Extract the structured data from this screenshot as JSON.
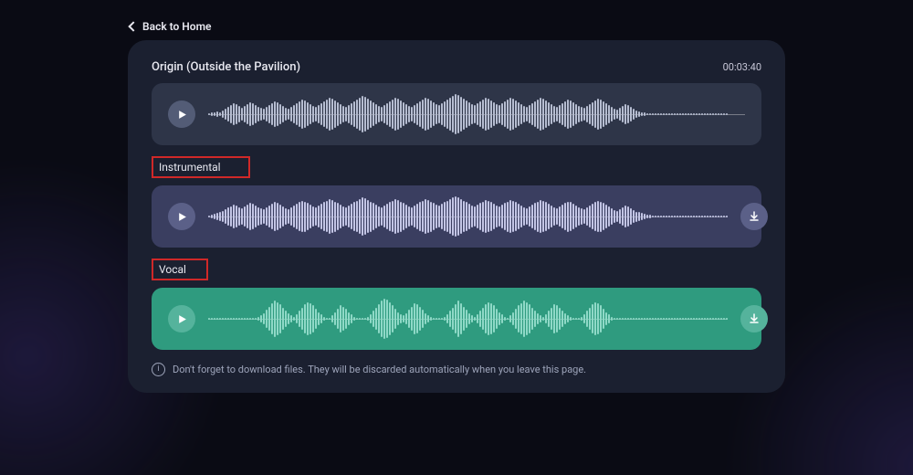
{
  "nav": {
    "back_label": "Back to Home"
  },
  "header": {
    "title": "Origin (Outside the Pavilion)",
    "duration": "00:03:40"
  },
  "tracks": {
    "instrumental_label": "Instrumental",
    "vocal_label": "Vocal"
  },
  "footer": {
    "note": "Don't forget to download files. They will be discarded automatically when you leave this page."
  },
  "waves": {
    "origin": [
      1,
      2,
      2,
      3,
      2,
      4,
      6,
      8,
      10,
      12,
      11,
      9,
      7,
      9,
      11,
      13,
      12,
      10,
      8,
      7,
      6,
      8,
      10,
      12,
      14,
      13,
      11,
      9,
      7,
      6,
      8,
      10,
      12,
      14,
      16,
      15,
      13,
      11,
      9,
      8,
      10,
      12,
      14,
      16,
      18,
      17,
      15,
      13,
      11,
      9,
      8,
      10,
      12,
      14,
      16,
      18,
      20,
      19,
      17,
      15,
      13,
      11,
      9,
      8,
      10,
      12,
      14,
      16,
      18,
      17,
      15,
      13,
      11,
      9,
      8,
      10,
      12,
      14,
      16,
      18,
      17,
      15,
      13,
      11,
      10,
      12,
      14,
      16,
      18,
      20,
      22,
      21,
      19,
      17,
      15,
      13,
      11,
      10,
      12,
      14,
      16,
      18,
      17,
      15,
      13,
      11,
      10,
      12,
      14,
      16,
      18,
      17,
      15,
      13,
      11,
      9,
      8,
      10,
      12,
      14,
      16,
      18,
      17,
      15,
      13,
      11,
      9,
      8,
      10,
      12,
      14,
      16,
      15,
      13,
      11,
      9,
      8,
      7,
      9,
      11,
      13,
      15,
      17,
      16,
      14,
      12,
      10,
      8,
      6,
      5,
      7,
      9,
      11,
      10,
      8,
      6,
      4,
      3,
      2,
      2,
      1,
      1,
      1,
      1,
      1,
      1,
      1,
      1,
      1,
      1,
      1,
      1,
      1,
      1,
      1,
      1,
      1,
      1,
      1,
      1,
      1,
      1,
      1,
      1,
      1,
      1,
      1,
      1,
      1,
      1
    ],
    "instrumental": [
      1,
      2,
      3,
      4,
      5,
      7,
      9,
      11,
      12,
      14,
      13,
      11,
      10,
      12,
      14,
      16,
      15,
      13,
      11,
      10,
      9,
      11,
      13,
      15,
      17,
      16,
      14,
      12,
      10,
      9,
      11,
      13,
      15,
      17,
      19,
      18,
      16,
      14,
      12,
      11,
      13,
      15,
      17,
      19,
      21,
      20,
      18,
      16,
      14,
      12,
      11,
      13,
      15,
      17,
      19,
      21,
      23,
      22,
      20,
      18,
      16,
      14,
      12,
      11,
      13,
      15,
      17,
      19,
      21,
      20,
      18,
      16,
      14,
      12,
      11,
      13,
      15,
      17,
      19,
      21,
      20,
      18,
      16,
      14,
      13,
      15,
      17,
      19,
      21,
      23,
      24,
      23,
      21,
      19,
      17,
      15,
      13,
      12,
      14,
      16,
      18,
      20,
      19,
      17,
      15,
      13,
      12,
      14,
      16,
      18,
      20,
      19,
      17,
      15,
      13,
      11,
      10,
      12,
      14,
      16,
      18,
      20,
      19,
      17,
      15,
      13,
      11,
      10,
      12,
      14,
      16,
      18,
      17,
      15,
      13,
      11,
      10,
      9,
      11,
      13,
      15,
      17,
      19,
      18,
      16,
      14,
      12,
      10,
      8,
      7,
      9,
      11,
      13,
      12,
      10,
      8,
      6,
      5,
      4,
      3,
      2,
      2,
      1,
      1,
      1,
      1,
      1,
      1,
      1,
      1,
      1,
      1,
      1,
      1,
      1,
      1,
      1,
      1,
      1,
      1,
      1,
      1,
      1,
      1,
      1,
      1,
      1,
      1,
      1,
      1
    ],
    "vocal": [
      1,
      1,
      1,
      1,
      1,
      1,
      1,
      1,
      1,
      1,
      1,
      1,
      1,
      1,
      1,
      1,
      1,
      1,
      2,
      3,
      5,
      8,
      11,
      14,
      16,
      15,
      13,
      10,
      7,
      5,
      3,
      2,
      4,
      7,
      10,
      13,
      15,
      14,
      12,
      9,
      6,
      4,
      2,
      1,
      1,
      3,
      6,
      9,
      12,
      11,
      9,
      6,
      4,
      2,
      1,
      1,
      1,
      1,
      2,
      4,
      7,
      10,
      13,
      16,
      18,
      17,
      15,
      12,
      9,
      6,
      4,
      3,
      5,
      8,
      11,
      14,
      13,
      11,
      8,
      5,
      3,
      2,
      1,
      1,
      1,
      1,
      2,
      4,
      7,
      10,
      13,
      16,
      14,
      11,
      8,
      5,
      3,
      2,
      4,
      7,
      10,
      13,
      15,
      14,
      12,
      9,
      6,
      4,
      2,
      1,
      3,
      6,
      9,
      12,
      14,
      16,
      15,
      13,
      10,
      7,
      5,
      3,
      2,
      4,
      7,
      10,
      13,
      12,
      10,
      7,
      5,
      3,
      2,
      1,
      1,
      1,
      2,
      4,
      7,
      10,
      13,
      15,
      14,
      12,
      9,
      6,
      4,
      2,
      1,
      1,
      1,
      1,
      1,
      1,
      1,
      1,
      1,
      1,
      1,
      1,
      1,
      1,
      1,
      1,
      1,
      1,
      1,
      1,
      1,
      1,
      1,
      1,
      1,
      1,
      1,
      1,
      1,
      1,
      1,
      1,
      1,
      1,
      1,
      1,
      1,
      1,
      1,
      1,
      1,
      1
    ]
  }
}
